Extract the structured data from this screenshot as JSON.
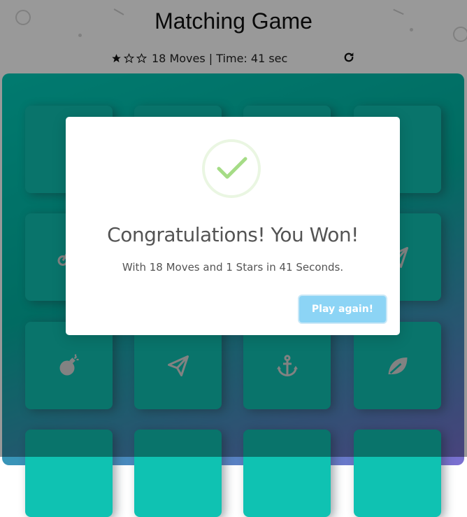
{
  "header": {
    "title": "Matching Game",
    "score_text": "18 Moves | Time: 41 sec",
    "stars": {
      "filled": 1,
      "total": 3
    },
    "restart_icon": "redo-icon"
  },
  "deck": {
    "rows": 4,
    "cols": 4,
    "visible_card_icons": [
      "bomb-icon",
      "paper-plane-icon",
      "anchor-icon",
      "leaf-icon",
      "bicycle-icon"
    ],
    "colors": {
      "card": "#0fc2b2",
      "icon": "#d9d9d9"
    }
  },
  "modal": {
    "title": "Congratulations! You Won!",
    "message": "With 18 Moves and 1 Stars in 41 Seconds.",
    "button_label": "Play again!",
    "icon": "checkmark-icon",
    "colors": {
      "button": "#8cd4f5",
      "check": "#a5dc86",
      "text": "#545454"
    }
  }
}
